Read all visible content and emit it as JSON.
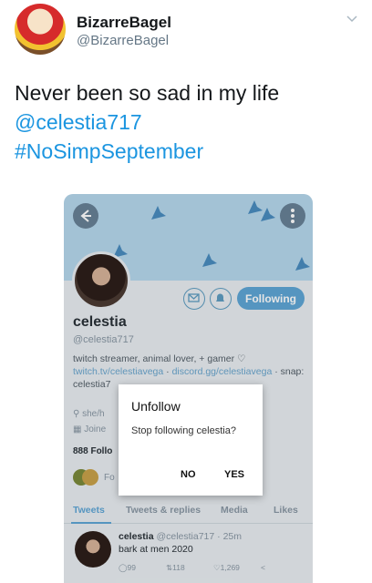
{
  "tweet": {
    "display_name": "BizarreBagel",
    "handle": "@BizarreBagel",
    "text_line1": "Never been so sad in my life",
    "mention": "@celestia717",
    "hashtag": "#NoSimpSeptember"
  },
  "embedded_profile": {
    "following_label": "Following",
    "name": "celestia",
    "handle": "@celestia717",
    "bio_part1": "twitch streamer, animal lover, + gamer ♡ ",
    "bio_link1": "twitch.tv/celestiavega",
    "bio_sep": " · ",
    "bio_link2": "discord.gg/celestiavega",
    "bio_part2": " · snap:",
    "bio_line3": "celestia7",
    "location_fragment": "she/h",
    "joined_fragment": "Joine",
    "stats_fragment": "888 Follo",
    "followers_fragment": "Fo",
    "tabs": [
      "Tweets",
      "Tweets & replies",
      "Media",
      "Likes"
    ],
    "pinned_tweet": {
      "name": "celestia",
      "handle_time": "@celestia717 · 25m",
      "text": "bark at men 2020",
      "replies": "99",
      "retweets": "118",
      "likes": "1,269"
    }
  },
  "dialog": {
    "title": "Unfollow",
    "message": "Stop following celestia?",
    "no_label": "NO",
    "yes_label": "YES"
  },
  "icons": {
    "chevron": "chevron-down-icon",
    "back": "back-arrow-icon",
    "more": "more-vertical-icon",
    "message": "message-icon",
    "notify": "notification-bell-icon",
    "banner_birds": "bird-icon"
  },
  "colors": {
    "twitter_link": "#1b95e0",
    "following_button": "#5fa6d6",
    "banner": "#b6d8ee"
  }
}
